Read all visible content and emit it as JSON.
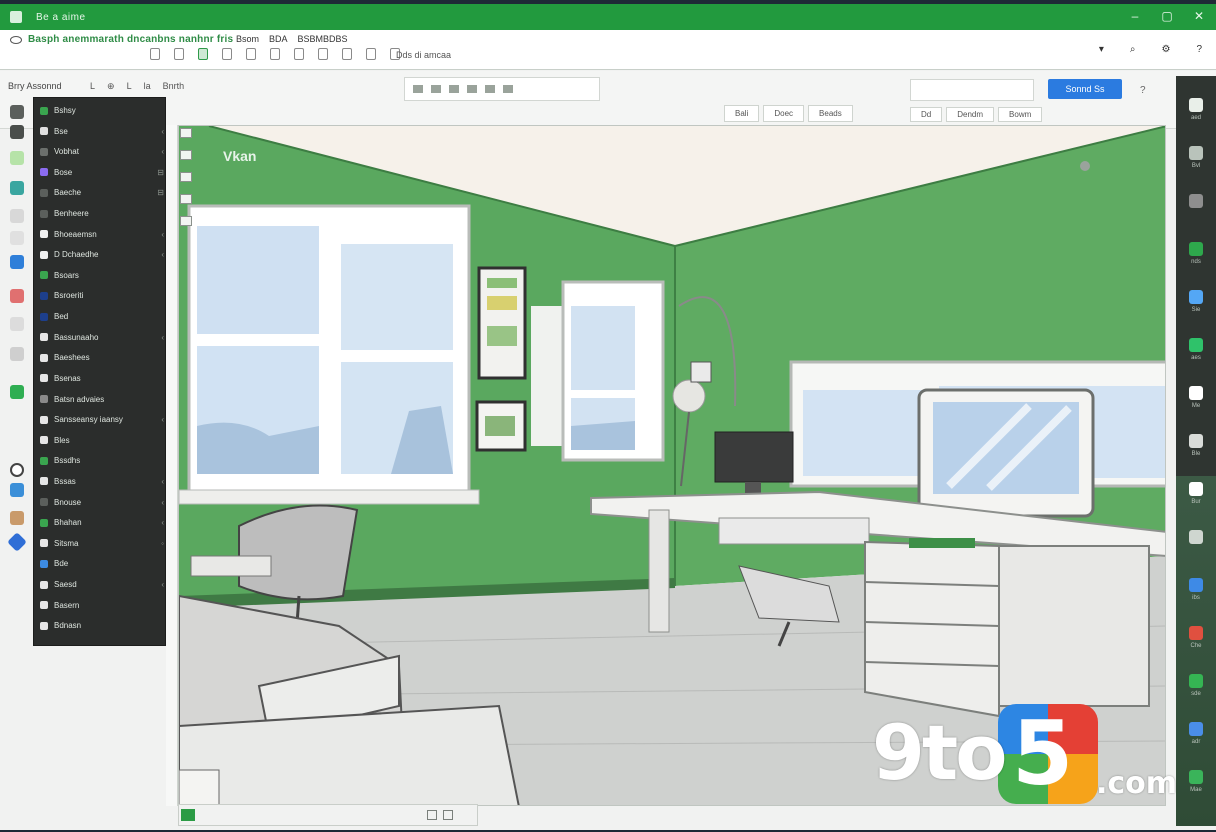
{
  "window": {
    "title": "Be a aime",
    "controls": [
      "–",
      "▢",
      "✕"
    ]
  },
  "menubar": {
    "app_name": "Basph anemmarath dncanbns nanhnr fris",
    "menu_items": [
      "Bsom",
      "BDA",
      "BSBMBDBS"
    ],
    "subtitle": "",
    "doc_name": "Dds di amcaa",
    "right_icons": [
      "▾",
      "⌕",
      "⚙",
      "?"
    ]
  },
  "ribbon": {
    "label": "Brry Assonnd",
    "tools": [
      "L",
      "⊕",
      "L",
      "la",
      "Bnrth"
    ],
    "share_label": "Sonnd Ss",
    "mini_dropdowns": [
      "Bali",
      "Doec",
      "Beads"
    ],
    "view_dropdowns": [
      "Dd",
      "Dendm",
      "Bowm"
    ],
    "help": "?"
  },
  "layers": [
    {
      "label": "Bshsy",
      "color": "#3aa54f",
      "ctl": ""
    },
    {
      "label": "Bse",
      "color": "#e0e0e0",
      "ctl": "‹"
    },
    {
      "label": "Vobhat",
      "color": "#6b6f6c",
      "ctl": "‹"
    },
    {
      "label": "Bose",
      "color": "#8b6cf0",
      "ctl": "⊟"
    },
    {
      "label": "Baeche",
      "color": "#5b5f5c",
      "ctl": "⊟"
    },
    {
      "label": "Benheere",
      "color": "#5b5f5c",
      "ctl": ""
    },
    {
      "label": "Bhoeaemsn",
      "color": "#f0f0f0",
      "ctl": "‹"
    },
    {
      "label": "D Dchaedhe",
      "color": "#f0f0f0",
      "ctl": "‹"
    },
    {
      "label": "Bsoars",
      "color": "#3aa54f",
      "ctl": ""
    },
    {
      "label": "Bsroeriti",
      "color": "#1d3f8c",
      "ctl": ""
    },
    {
      "label": "Bed",
      "color": "#1d3f8c",
      "ctl": ""
    },
    {
      "label": "Bassunaaho",
      "color": "#e6e6e6",
      "ctl": "‹"
    },
    {
      "label": "Baeshees",
      "color": "#e6e6e6",
      "ctl": ""
    },
    {
      "label": "Bsenas",
      "color": "#e6e6e6",
      "ctl": ""
    },
    {
      "label": "Batsn advaies",
      "color": "#8a8a8a",
      "ctl": ""
    },
    {
      "label": "Sansseansy iaansy",
      "color": "#e6e6e6",
      "ctl": "‹"
    },
    {
      "label": "Bles",
      "color": "#e6e6e6",
      "ctl": ""
    },
    {
      "label": "Bssdhs",
      "color": "#3aa54f",
      "ctl": ""
    },
    {
      "label": "Bssas",
      "color": "#e6e6e6",
      "ctl": "‹"
    },
    {
      "label": "Bnouse",
      "color": "#5b5f5c",
      "ctl": "‹"
    },
    {
      "label": "Bhahan",
      "color": "#3aa54f",
      "ctl": "‹"
    },
    {
      "label": "Sitsma",
      "color": "#e6e6e6",
      "ctl": "◦"
    },
    {
      "label": "Bde",
      "color": "#3d8be2",
      "ctl": ""
    },
    {
      "label": "Saesd",
      "color": "#e6e6e6",
      "ctl": "‹"
    },
    {
      "label": "Basern",
      "color": "#e6e6e6",
      "ctl": ""
    },
    {
      "label": "Bdnasn",
      "color": "#e6e6e6",
      "ctl": ""
    }
  ],
  "canvas": {
    "view_label": "Vkan"
  },
  "right_dock": [
    {
      "color": "#e9efe9",
      "label": "aed"
    },
    {
      "color": "#b9c3bb",
      "label": "Bvl"
    },
    {
      "color": "#8e8e8e",
      "label": ""
    },
    {
      "color": "#2ea84c",
      "label": "nds"
    },
    {
      "color": "#54a7f5",
      "label": "Sie"
    },
    {
      "color": "#2fc26a",
      "label": "aes"
    },
    {
      "color": "#ffffff",
      "label": "Me"
    },
    {
      "color": "#d9dcd9",
      "label": "Ble"
    },
    {
      "color": "#ffffff",
      "label": "Bur"
    },
    {
      "color": "#cfd6d0",
      "label": ""
    },
    {
      "color": "#3e8ae6",
      "label": "ibs"
    },
    {
      "color": "#e0503f",
      "label": "Che"
    },
    {
      "color": "#35b553",
      "label": "sde"
    },
    {
      "color": "#4a8ee8",
      "label": "adr"
    },
    {
      "color": "#3ab45a",
      "label": "Mae"
    }
  ],
  "watermark": {
    "text": "9to",
    "five": "5",
    "suffix": ".com"
  },
  "colors": {
    "accent": "#229a3e",
    "wall_green": "#5da95f",
    "panel_dark": "#2b2d2c",
    "share_blue": "#2b7be0"
  }
}
